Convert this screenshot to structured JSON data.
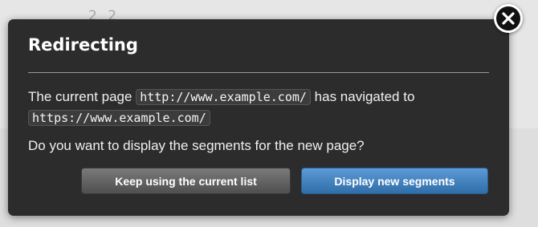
{
  "background": {
    "number": "2 2"
  },
  "dialog": {
    "title": "Redirecting",
    "message_prefix": "The current page",
    "current_url": "http://www.example.com/",
    "message_middle": "has navigated to",
    "new_url": "https://www.example.com/",
    "question": "Do you want to display the segments for the new page?",
    "keep_button_label": "Keep using the current list",
    "display_button_label": "Display new segments",
    "close_icon": "close-icon"
  },
  "colors": {
    "dialog_background": "#2c2c2c",
    "primary_button": "#3f82c4",
    "secondary_button": "#666666"
  }
}
